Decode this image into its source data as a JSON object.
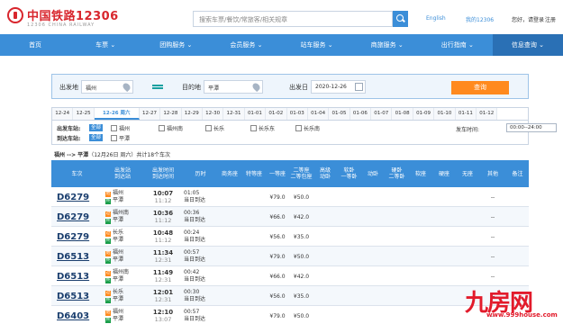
{
  "header": {
    "brand_cn": "中国铁路12306",
    "brand_en": "12306 CHINA RAILWAY",
    "search_placeholder": "搜索车票/餐饮/常旅客/相关规章",
    "lang": "English",
    "my": "我的12306",
    "greeting": "您好，请登录",
    "register": "注册"
  },
  "nav": [
    {
      "label": "首页"
    },
    {
      "label": "车票 ⌄"
    },
    {
      "label": "团购服务 ⌄"
    },
    {
      "label": "会员服务 ⌄"
    },
    {
      "label": "站车服务 ⌄"
    },
    {
      "label": "商旅服务 ⌄"
    },
    {
      "label": "出行指南 ⌄"
    },
    {
      "label": "信息查询 ⌄"
    }
  ],
  "form": {
    "from_label": "出发地",
    "from_value": "福州",
    "to_label": "目的地",
    "to_value": "平潭",
    "date_label": "出发日",
    "date_value": "2020-12-26",
    "query_button": "查询"
  },
  "dates": [
    "12-24",
    "12-25",
    "12-26 周六",
    "12-27",
    "12-28",
    "12-29",
    "12-30",
    "12-31",
    "01-01",
    "01-02",
    "01-03",
    "01-04",
    "01-05",
    "01-06",
    "01-07",
    "01-08",
    "01-09",
    "01-10",
    "01-11",
    "01-12"
  ],
  "filters": {
    "dep_label": "出发车站:",
    "arr_label": "到达车站:",
    "all": "全部",
    "dep_stations": [
      "福州",
      "福州南",
      "长乐",
      "长乐东",
      "长乐南"
    ],
    "arr_stations": [
      "平潭"
    ],
    "time_label": "发车时间:",
    "time_value": "00:00--24:00"
  },
  "result": {
    "route": "福州 --> 平潭",
    "date": "（12月26日 周六）",
    "count": "共计18个车次"
  },
  "table": {
    "headers": [
      "车次",
      "出发站\n到达站",
      "出发时间\n到达时间",
      "历时",
      "商务座",
      "特等座",
      "一等座",
      "二等座\n二等包座",
      "高级\n动卧",
      "软卧\n一等卧",
      "动卧",
      "硬卧\n二等卧",
      "软座",
      "硬座",
      "无座",
      "其他",
      "备注"
    ],
    "rows": [
      {
        "train": "D6279",
        "from": "福州",
        "from_tag": "始",
        "to": "平潭",
        "dep": "10:07",
        "arr": "11:12",
        "dur": "01:05",
        "dur2": "当日到达",
        "first": "¥79.0",
        "second": "¥50.0"
      },
      {
        "train": "D6279",
        "from": "福州南",
        "from_tag": "过",
        "to": "平潭",
        "dep": "10:36",
        "arr": "11:12",
        "dur": "00:36",
        "dur2": "当日到达",
        "first": "¥66.0",
        "second": "¥42.0"
      },
      {
        "train": "D6279",
        "from": "长乐",
        "from_tag": "过",
        "to": "平潭",
        "dep": "10:48",
        "arr": "11:12",
        "dur": "00:24",
        "dur2": "当日到达",
        "first": "¥56.0",
        "second": "¥35.0"
      },
      {
        "train": "D6513",
        "from": "福州",
        "from_tag": "始",
        "to": "平潭",
        "dep": "11:34",
        "arr": "12:31",
        "dur": "00:57",
        "dur2": "当日到达",
        "first": "¥79.0",
        "second": "¥50.0"
      },
      {
        "train": "D6513",
        "from": "福州南",
        "from_tag": "过",
        "to": "平潭",
        "dep": "11:49",
        "arr": "12:31",
        "dur": "00:42",
        "dur2": "当日到达",
        "first": "¥66.0",
        "second": "¥42.0"
      },
      {
        "train": "D6513",
        "from": "长乐",
        "from_tag": "过",
        "to": "平潭",
        "dep": "12:01",
        "arr": "12:31",
        "dur": "00:30",
        "dur2": "当日到达",
        "first": "¥56.0",
        "second": "¥35.0"
      },
      {
        "train": "D6403",
        "from": "福州",
        "from_tag": "始",
        "to": "平潭",
        "dep": "12:10",
        "arr": "13:07",
        "dur": "00:57",
        "dur2": "当日到达",
        "first": "¥79.0",
        "second": "¥50.0"
      }
    ],
    "other": "--"
  },
  "watermark": {
    "main": "九房网",
    "url": "www.999house.com"
  },
  "colors": {
    "nav_blue": "#3b8ed8",
    "brand_red": "#d8262d",
    "query_orange": "#ff8a1e",
    "price_green": "#1a9e4a"
  }
}
